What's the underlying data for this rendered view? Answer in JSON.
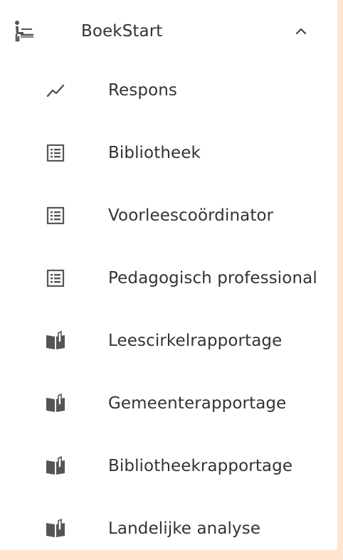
{
  "menu": {
    "section": {
      "label": "BoekStart",
      "icon": "reading-child-icon",
      "expanded": true,
      "chevron_icon": "chevron-up-icon"
    },
    "items": [
      {
        "label": "Respons",
        "icon": "trending-line-icon"
      },
      {
        "label": "Bibliotheek",
        "icon": "list-icon"
      },
      {
        "label": "Voorleescoördinator",
        "icon": "list-icon"
      },
      {
        "label": "Pedagogisch professional",
        "icon": "list-icon"
      },
      {
        "label": "Leescirkelrapportage",
        "icon": "open-book-icon"
      },
      {
        "label": "Gemeenterapportage",
        "icon": "open-book-icon"
      },
      {
        "label": "Bibliotheekrapportage",
        "icon": "open-book-icon"
      },
      {
        "label": "Landelijke analyse",
        "icon": "open-book-icon"
      }
    ]
  },
  "colors": {
    "background_accent": "#ffe4cf",
    "panel": "#ffffff",
    "text": "#333333",
    "icon": "#555555"
  }
}
